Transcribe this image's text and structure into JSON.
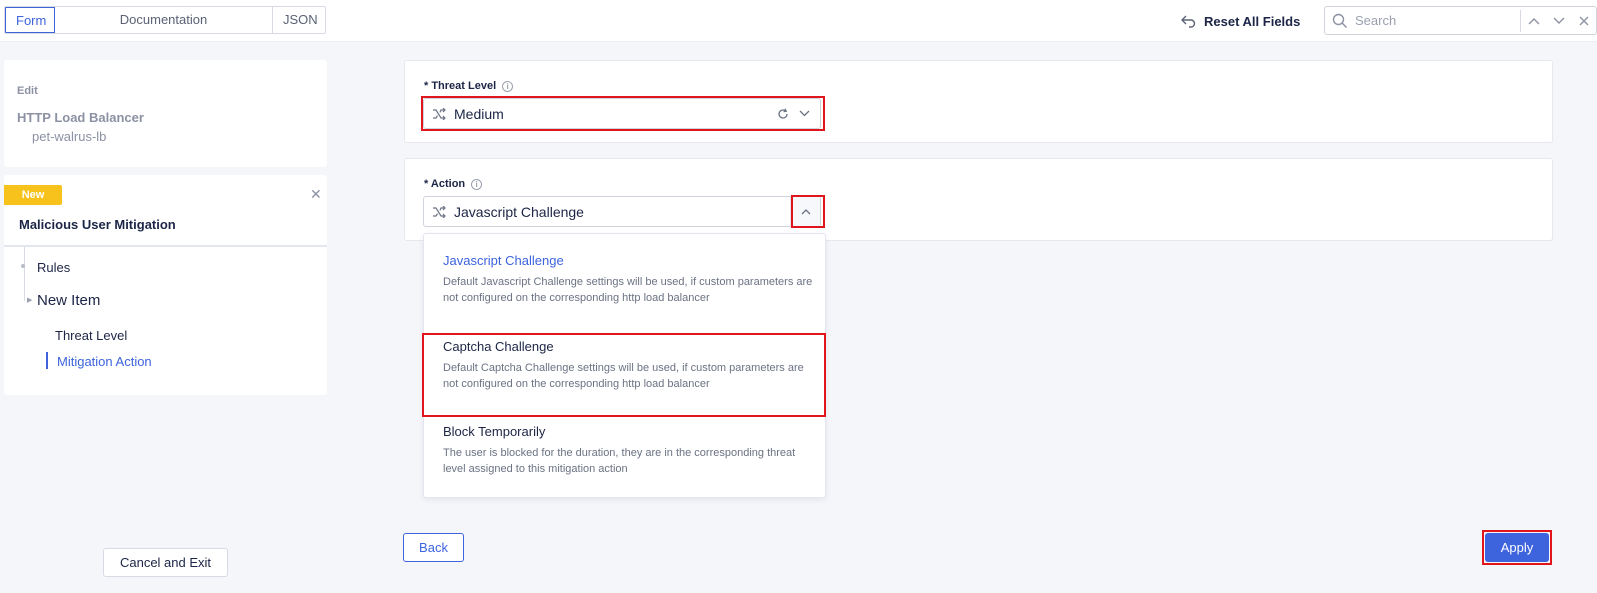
{
  "view_tabs": [
    {
      "label": "Form",
      "active": true
    },
    {
      "label": "Documentation",
      "active": false
    },
    {
      "label": "JSON",
      "active": false
    }
  ],
  "toolbar": {
    "reset_label": "Reset All Fields",
    "search_placeholder": "Search"
  },
  "sidebar": {
    "edit_label": "Edit",
    "object_type": "HTTP Load Balancer",
    "object_name": "pet-walrus-lb",
    "badge": "New",
    "section_title": "Malicious User Mitigation",
    "nav": {
      "rules": "Rules",
      "new_item": "New Item",
      "threat_level": "Threat Level",
      "mitigation_action": "Mitigation Action"
    },
    "cancel_label": "Cancel and Exit"
  },
  "form": {
    "threat_level": {
      "label": "* Threat Level",
      "value": "Medium"
    },
    "action": {
      "label": "* Action",
      "value": "Javascript Challenge",
      "options": [
        {
          "title": "Javascript Challenge",
          "description": "Default Javascript Challenge settings will be used, if custom parameters are not configured on the corresponding http load balancer",
          "selected": true
        },
        {
          "title": "Captcha Challenge",
          "description": "Default Captcha Challenge settings will be used, if custom parameters are not configured on the corresponding http load balancer",
          "selected": false
        },
        {
          "title": "Block Temporarily",
          "description": "The user is blocked for the duration, they are in the corresponding threat level assigned to this mitigation action",
          "selected": false
        }
      ]
    }
  },
  "footer": {
    "back_label": "Back",
    "apply_label": "Apply"
  },
  "colors": {
    "accent": "#3d63dd",
    "highlight": "#e0161c",
    "badge": "#f6c21b"
  }
}
